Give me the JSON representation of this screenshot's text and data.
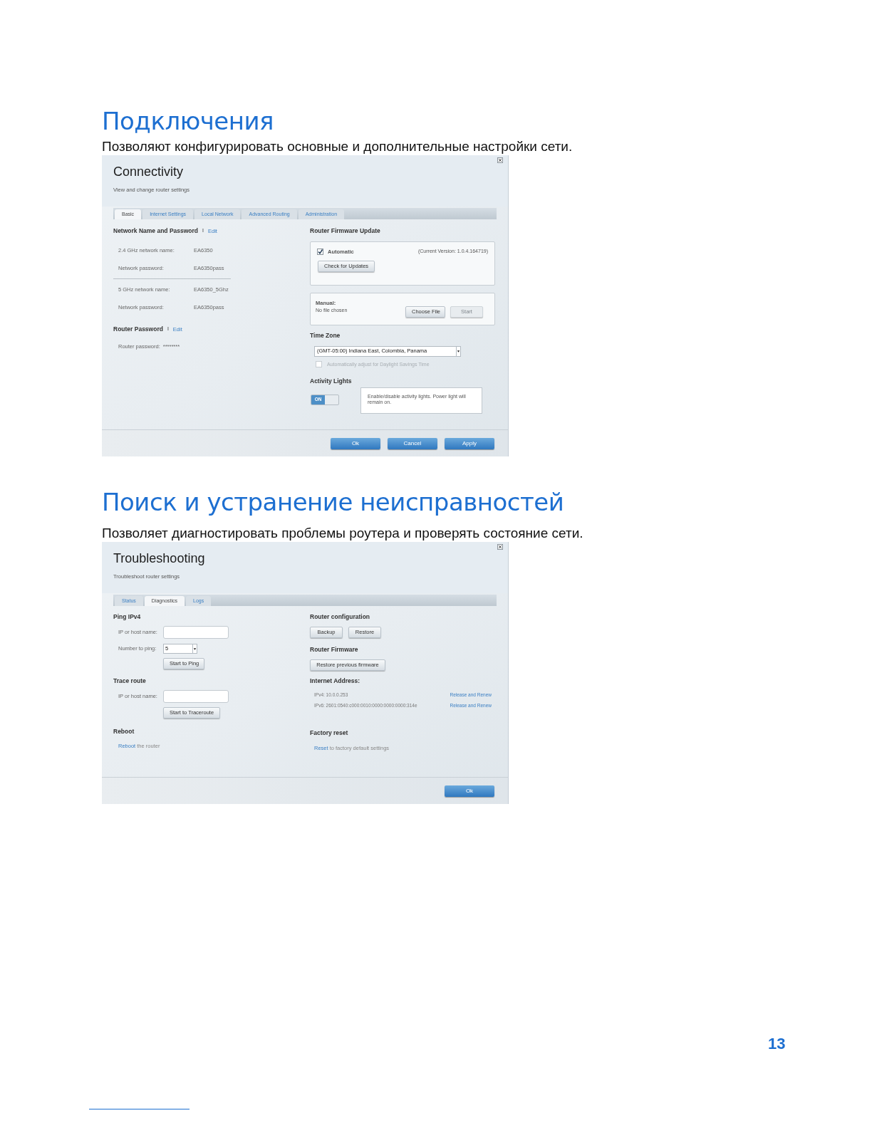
{
  "sections": [
    {
      "heading": "Подключения",
      "description": "Позволяют конфигурировать основные и дополнительные настройки сети.",
      "window": {
        "kind": "connectivity",
        "title": "Connectivity",
        "subtitle": "View and change router settings",
        "tabs": [
          {
            "label": "Basic",
            "selected": true
          },
          {
            "label": "Internet Settings",
            "selected": false
          },
          {
            "label": "Local Network",
            "selected": false
          },
          {
            "label": "Advanced Routing",
            "selected": false
          },
          {
            "label": "Administration",
            "selected": false
          }
        ],
        "network": {
          "heading": "Network Name and Password",
          "separator": "I",
          "link": "Edit",
          "rows": [
            {
              "label": "2.4 GHz network name:",
              "value": "EA6350"
            },
            {
              "label": "Network password:",
              "value": "EA6350pass"
            },
            {
              "label": "5 GHz network name:",
              "value": "EA6350_5Ghz"
            },
            {
              "label": "Network password:",
              "value": "EA6350pass"
            }
          ]
        },
        "router_password": {
          "heading": "Router Password",
          "separator": "I",
          "link": "Edit",
          "label": "Router password:",
          "value": "********"
        },
        "firmware": {
          "heading": "Router Firmware Update",
          "automatic": {
            "label": "Automatic",
            "checked": true
          },
          "version": "(Current Version: 1.0.4.164719)",
          "check_button": "Check for Updates",
          "manual_label": "Manual:",
          "file_status": "No file chosen",
          "choose_button": "Choose File",
          "start_button": {
            "label": "Start",
            "disabled": true
          }
        },
        "time_zone": {
          "heading": "Time Zone",
          "value": "(GMT-05:00) Indiana East, Colombia, Panama",
          "dst": {
            "label": "Automatically adjust for Daylight Savings Time",
            "checked": false,
            "disabled": true
          }
        },
        "activity_lights": {
          "heading": "Activity Lights",
          "on": true,
          "toggle_label": "ON",
          "note": "Enable/disable activity lights. Power light will remain on."
        },
        "buttons": [
          "Ok",
          "Cancel",
          "Apply"
        ]
      }
    },
    {
      "heading": "Поиск и устранение неисправностей",
      "description": "Позволяет диагностировать проблемы роутера и проверять состояние сети.",
      "window": {
        "kind": "troubleshooting",
        "title": "Troubleshooting",
        "subtitle": "Troubleshoot router settings",
        "tabs": [
          {
            "label": "Status",
            "selected": false
          },
          {
            "label": "Diagnostics",
            "selected": true
          },
          {
            "label": "Logs",
            "selected": false
          }
        ],
        "ping": {
          "heading": "Ping IPv4",
          "host_label": "IP or host name:",
          "count_label": "Number to ping:",
          "count_value": "5",
          "button": "Start to Ping"
        },
        "trace": {
          "heading": "Trace route",
          "host_label": "IP or host name:",
          "button": "Start to Traceroute"
        },
        "reboot": {
          "heading": "Reboot",
          "link": "Reboot",
          "text": " the router"
        },
        "config": {
          "heading": "Router configuration",
          "buttons": [
            "Backup",
            "Restore"
          ]
        },
        "firmware": {
          "heading": "Router Firmware",
          "button": "Restore previous firmware"
        },
        "internet": {
          "heading": "Internet Address:",
          "rows": [
            {
              "address": "IPv4: 10.0.0.253",
              "link": "Release and Renew"
            },
            {
              "address": "IPv6: 2601:0540:c000:0010:0000:0000:0000:314e",
              "link": "Release and Renew"
            }
          ]
        },
        "factory": {
          "heading": "Factory reset",
          "link": "Reset",
          "text": " to factory default settings"
        },
        "buttons": [
          "Ok"
        ]
      }
    }
  ],
  "page_number": "13"
}
